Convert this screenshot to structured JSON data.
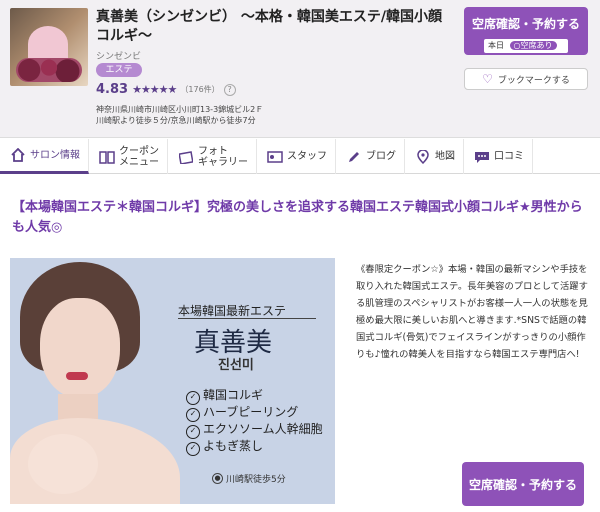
{
  "shop": {
    "name": "真善美（シンゼンビ） ～本格・韓国美エステ/韓国小顔コルギ～",
    "kana": "シンゼンビ",
    "category": "エステ",
    "rating": "4.83",
    "stars_value": 4.83,
    "review_count": "（176件）",
    "help": "?",
    "address_line1": "神奈川県川崎市川崎区小川町13-3錦城ビル2Ｆ",
    "address_line2": "川崎駅より徒歩５分/京急川崎駅から徒歩7分"
  },
  "header_actions": {
    "reserve_label": "空席確認・予約する",
    "today_label": "本日",
    "availability": "空席あり",
    "bookmark_label": "ブックマークする"
  },
  "tabs": [
    {
      "label": "サロン情報",
      "icon": "home-icon",
      "active": true
    },
    {
      "label": "クーポン\nメニュー",
      "icon": "book-icon",
      "active": false
    },
    {
      "label": "フォト\nギャラリー",
      "icon": "photo-icon",
      "active": false
    },
    {
      "label": "スタッフ",
      "icon": "id-card-icon",
      "active": false
    },
    {
      "label": "ブログ",
      "icon": "pencil-icon",
      "active": false
    },
    {
      "label": "地図",
      "icon": "map-pin-icon",
      "active": false
    },
    {
      "label": "口コミ",
      "icon": "chat-icon",
      "active": false
    }
  ],
  "headline": "【本場韓国エステ＊韓国コルギ】究極の美しさを追求する韓国エステ韓国式小顔コルギ★男性からも人気◎",
  "promo": {
    "subtitle": "本場韓国最新エステ",
    "title": "真善美",
    "korean": "진선미",
    "items": [
      "韓国コルギ",
      "ハーブピーリング",
      "エクソソーム人幹細胞",
      "よもぎ蒸し"
    ],
    "station": "川崎駅徒歩5分"
  },
  "description": "《春限定クーポン☆》本場・韓国の最新マシンや手技を取り入れた韓国式エステ。長年美容のプロとして活躍する肌管理のスペシャリストがお客様一人一人の状態を見極め最大限に美しいお肌へと導きます.*SNSで話題の韓国式コルギ(骨気)でフェイスラインがすっきりの小顔作りも♪憧れの韓美人を目指すなら韓国エステ専門店へ!",
  "bottom_reserve_label": "空席確認・予約する",
  "colors": {
    "accent": "#8e52b8",
    "headline": "#6f3aa8"
  }
}
